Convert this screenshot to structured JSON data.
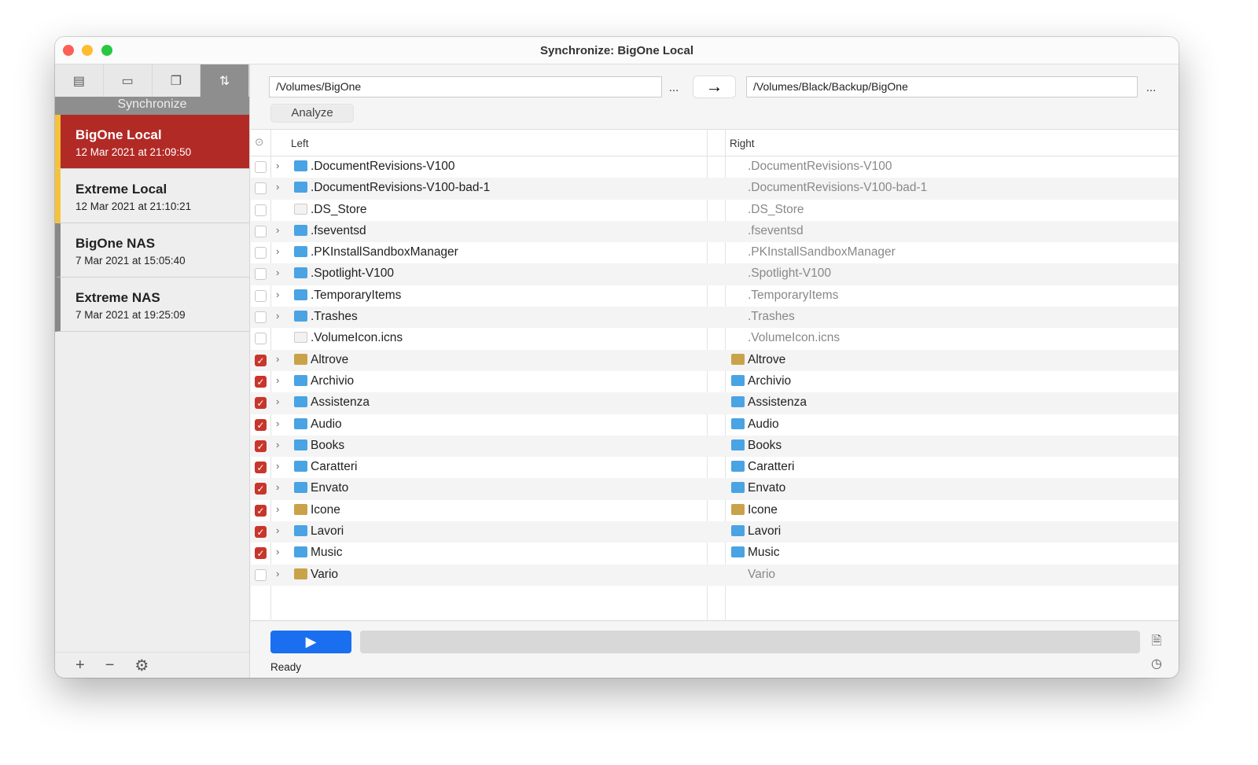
{
  "window": {
    "title": "Synchronize: BigOne Local"
  },
  "sidebar": {
    "mode_label": "Synchronize",
    "tabs": [
      {
        "icon": "drawer-icon"
      },
      {
        "icon": "archive-icon"
      },
      {
        "icon": "copy-icon"
      },
      {
        "icon": "sync-icon"
      }
    ],
    "profiles": [
      {
        "name": "BigOne Local",
        "date": "12 Mar 2021 at 21:09:50"
      },
      {
        "name": "Extreme Local",
        "date": "12 Mar 2021 at 21:10:21"
      },
      {
        "name": "BigOne NAS",
        "date": "7 Mar 2021 at 15:05:40"
      },
      {
        "name": "Extreme NAS",
        "date": "7 Mar 2021 at 19:25:09"
      }
    ],
    "footer": {
      "add": "+",
      "remove": "−",
      "settings": "⚙"
    }
  },
  "toolbar": {
    "left_path": "/Volumes/BigOne",
    "right_path": "/Volumes/Black/Backup/BigOne",
    "browse": "...",
    "analyze": "Analyze"
  },
  "table": {
    "col_left": "Left",
    "col_right": "Right",
    "rows": [
      {
        "name": ".DocumentRevisions-V100",
        "checked": false,
        "kind": "folder",
        "expand": true
      },
      {
        "name": ".DocumentRevisions-V100-bad-1",
        "checked": false,
        "kind": "folder",
        "expand": true
      },
      {
        "name": ".DS_Store",
        "checked": false,
        "kind": "file",
        "expand": false
      },
      {
        "name": ".fseventsd",
        "checked": false,
        "kind": "folder",
        "expand": true
      },
      {
        "name": ".PKInstallSandboxManager",
        "checked": false,
        "kind": "folder",
        "expand": true
      },
      {
        "name": ".Spotlight-V100",
        "checked": false,
        "kind": "folder",
        "expand": true
      },
      {
        "name": ".TemporaryItems",
        "checked": false,
        "kind": "folder",
        "expand": true
      },
      {
        "name": ".Trashes",
        "checked": false,
        "kind": "folder",
        "expand": true
      },
      {
        "name": ".VolumeIcon.icns",
        "checked": false,
        "kind": "file",
        "expand": false
      },
      {
        "name": "Altrove",
        "checked": true,
        "kind": "custom",
        "expand": true
      },
      {
        "name": "Archivio",
        "checked": true,
        "kind": "folder",
        "expand": true
      },
      {
        "name": "Assistenza",
        "checked": true,
        "kind": "folder",
        "expand": true
      },
      {
        "name": "Audio",
        "checked": true,
        "kind": "folder",
        "expand": true
      },
      {
        "name": "Books",
        "checked": true,
        "kind": "folder",
        "expand": true
      },
      {
        "name": "Caratteri",
        "checked": true,
        "kind": "folder",
        "expand": true
      },
      {
        "name": "Envato",
        "checked": true,
        "kind": "folder",
        "expand": true
      },
      {
        "name": "Icone",
        "checked": true,
        "kind": "custom",
        "expand": true
      },
      {
        "name": "Lavori",
        "checked": true,
        "kind": "folder",
        "expand": true
      },
      {
        "name": "Music",
        "checked": true,
        "kind": "folder",
        "expand": true
      },
      {
        "name": "Vario",
        "checked": false,
        "kind": "custom",
        "expand": true
      }
    ]
  },
  "status": {
    "text": "Ready",
    "progress": 0
  },
  "colors": {
    "accent": "#1a6ff0",
    "selected": "#b22a26",
    "check": "#c8362b"
  }
}
